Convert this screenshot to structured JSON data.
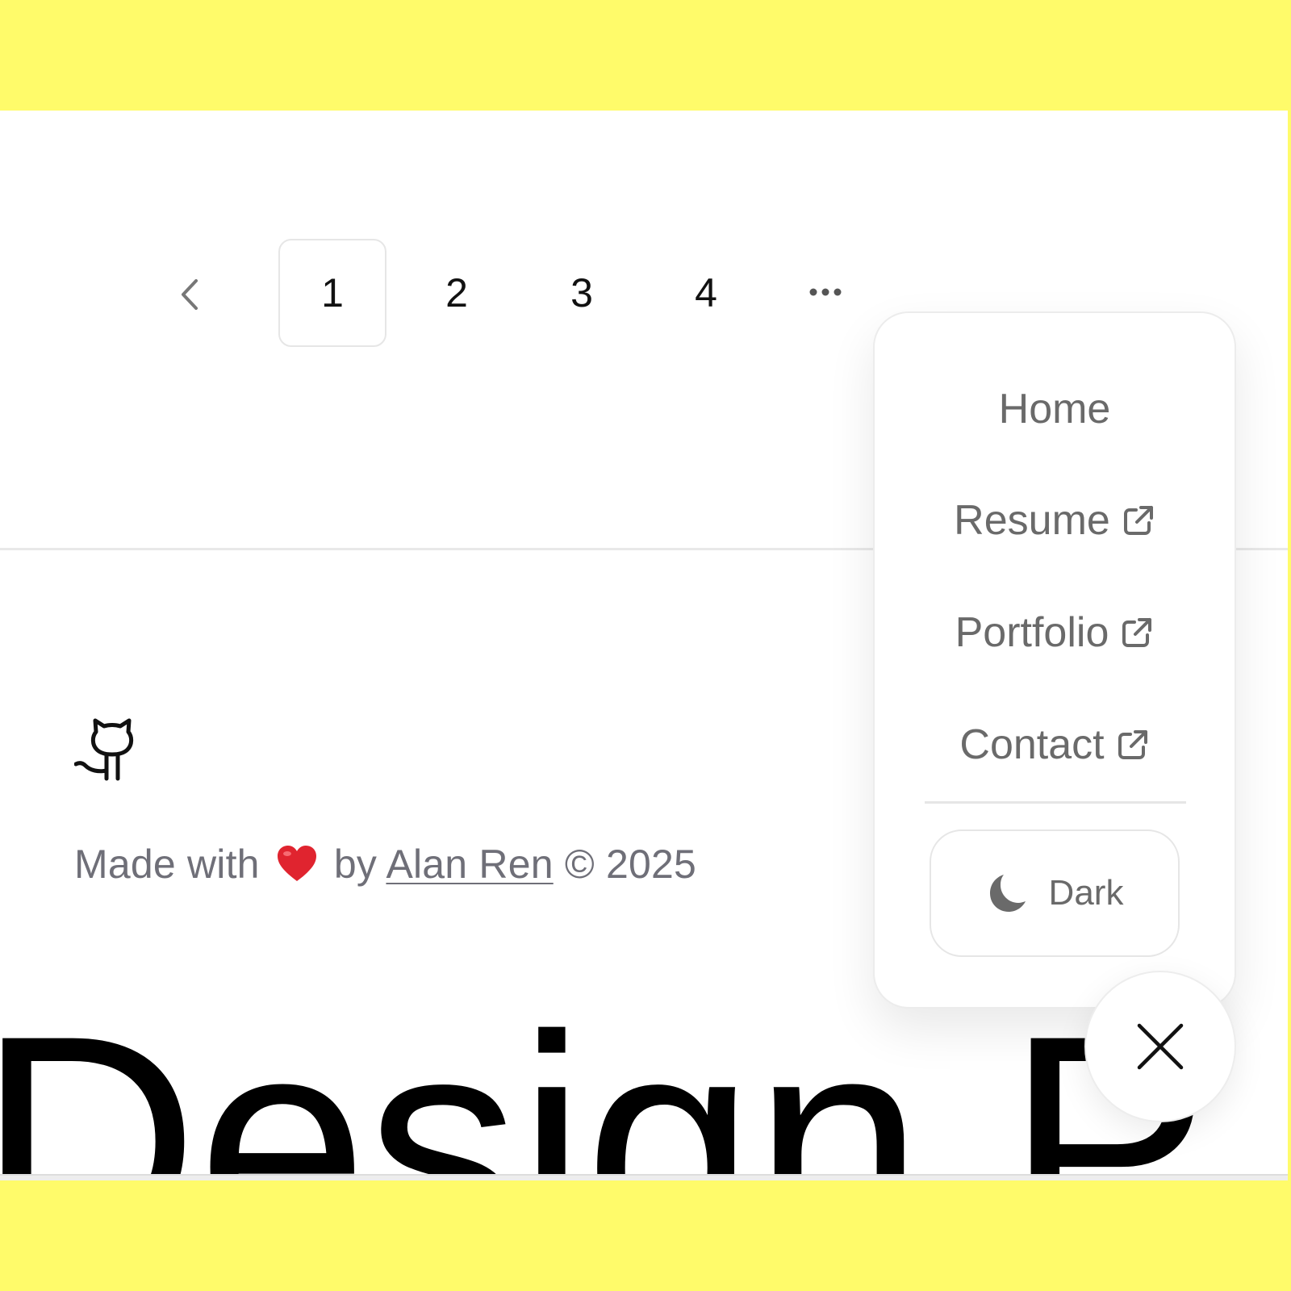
{
  "pagination": {
    "prev_icon": "chevron-left-icon",
    "pages": [
      "1",
      "2",
      "3",
      "4"
    ],
    "active_page": "1",
    "ellipsis_icon": "ellipsis-icon"
  },
  "footer": {
    "github_icon": "github-icon",
    "made_with": "Made with",
    "heart_icon": "heart-icon",
    "by": "by",
    "author": "Alan Ren",
    "copyright": "© 2025"
  },
  "hero": {
    "text": "Design P"
  },
  "menu": {
    "items": [
      {
        "label": "Home",
        "external": false
      },
      {
        "label": "Resume",
        "external": true
      },
      {
        "label": "Portfolio",
        "external": true
      },
      {
        "label": "Contact",
        "external": true
      }
    ],
    "theme_button": {
      "label": "Dark",
      "icon": "moon-icon"
    }
  },
  "close_button": {
    "icon": "close-icon"
  },
  "colors": {
    "frame": "#FFFB6A",
    "menu_text": "#6a6a6a",
    "footer_text": "#6f6f78",
    "heart": "#e0242f"
  }
}
